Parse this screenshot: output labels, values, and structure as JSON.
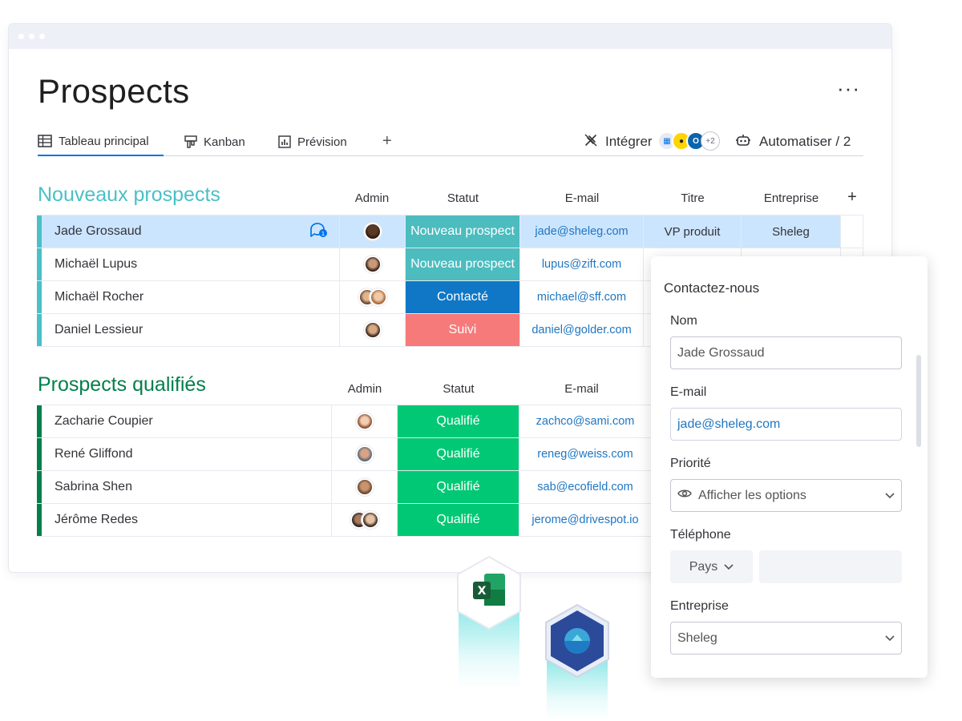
{
  "page": {
    "title": "Prospects",
    "more_icon": "more-horizontal-icon"
  },
  "tabs": {
    "items": [
      {
        "label": "Tableau principal",
        "icon": "table-icon"
      },
      {
        "label": "Kanban",
        "icon": "kanban-icon"
      },
      {
        "label": "Prévision",
        "icon": "chart-icon"
      }
    ],
    "add_label": "+",
    "integrate_label": "Intégrer",
    "integrations_more": "+2",
    "automate_label": "Automatiser / 2"
  },
  "group_new": {
    "title": "Nouveaux prospects",
    "color": "#4ac0c7",
    "columns": {
      "admin": "Admin",
      "status": "Statut",
      "email": "E-mail",
      "title": "Titre",
      "company": "Entreprise",
      "add": "+"
    },
    "rows": [
      {
        "name": "Jade Grossaud",
        "status": "Nouveau prospect",
        "status_color": "#4cbcbf",
        "email": "jade@sheleg.com",
        "title": "VP produit",
        "company": "Sheleg"
      },
      {
        "name": "Michaël Lupus",
        "status": "Nouveau prospect",
        "status_color": "#4cbcbf",
        "email": "lupus@zift.com"
      },
      {
        "name": "Michaël Rocher",
        "status": "Contacté",
        "status_color": "#0f77c6",
        "email": "michael@sff.com"
      },
      {
        "name": "Daniel Lessieur",
        "status": "Suivi",
        "status_color": "#f67a7a",
        "email": "daniel@golder.com"
      }
    ]
  },
  "group_qualified": {
    "title": "Prospects qualifiés",
    "color": "#037f4c",
    "columns": {
      "admin": "Admin",
      "status": "Statut",
      "email": "E-mail"
    },
    "rows": [
      {
        "name": "Zacharie Coupier",
        "status": "Qualifié",
        "status_color": "#00c875",
        "email": "zachco@sami.com"
      },
      {
        "name": "René Gliffond",
        "status": "Qualifié",
        "status_color": "#00c875",
        "email": "reneg@weiss.com"
      },
      {
        "name": "Sabrina Shen",
        "status": "Qualifié",
        "status_color": "#00c875",
        "email": "sab@ecofield.com"
      },
      {
        "name": "Jérôme Redes",
        "status": "Qualifié",
        "status_color": "#00c875",
        "email": "jerome@drivespot.io"
      }
    ]
  },
  "form": {
    "title": "Contactez-nous",
    "fields": {
      "name_label": "Nom",
      "name_value": "Jade Grossaud",
      "email_label": "E-mail",
      "email_value": "jade@sheleg.com",
      "priority_label": "Priorité",
      "priority_placeholder": "Afficher les options",
      "phone_label": "Téléphone",
      "country_label": "Pays",
      "company_label": "Entreprise",
      "company_value": "Sheleg"
    }
  },
  "colors": {
    "accent": "#0073ea",
    "selected_row": "#cce5ff",
    "email": "#1f76c2"
  }
}
